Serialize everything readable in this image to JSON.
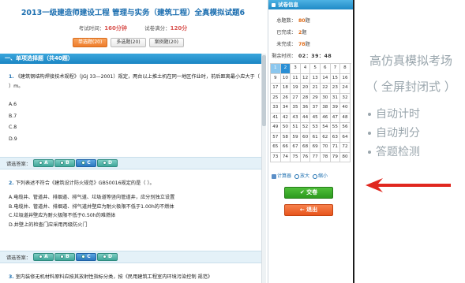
{
  "exam": {
    "title": "2013一级建造师建设工程 管理与实务（建筑工程）全真模拟试题6",
    "time_label": "考试时间：",
    "time_value": "160分钟",
    "score_label": "试卷满分：",
    "score_value": "120分",
    "tabs": [
      {
        "label": "单选题(20)",
        "active": true
      },
      {
        "label": "多选题(20)",
        "active": false
      },
      {
        "label": "案例题(20)",
        "active": false
      }
    ],
    "section_title": "一、单项选择题（共40题）"
  },
  "questions": [
    {
      "number": "1.",
      "stem": "《建筑钢结构焊接技术规程》（JGJ 33—2001）规定，两台以上推土机在同一地区作业时，前后距离最小应大于（ ）m。",
      "options": [
        "A.6",
        "B.7",
        "C.8",
        "D.9"
      ]
    },
    {
      "number": "2.",
      "stem": "下列表述不符合《建筑设计防火规范》GB50016规定的是（ ）。",
      "options": [
        "A.电缆井、管道井、排烟道、排气道、垃圾道等竖向管道井，应分别独立设置",
        "B.电缆井、管道井、排烟道、排气道井壁应为耐火极限不低于1.00h的不燃体",
        "C.垃圾道井壁应为耐火极限不低于0.50h的难燃体",
        "D.井壁上的检查门应采用丙级防火门"
      ]
    },
    {
      "number": "3.",
      "stem": "室内装修无机材料原料应按其放射性指标分类，按《民用建筑工程室内环境污染控制 规范》",
      "options": []
    }
  ],
  "answer_bar": {
    "label": "请选答案：",
    "choices": [
      "A",
      "B",
      "C",
      "D"
    ]
  },
  "panel": {
    "title": "试卷信息",
    "total_label": "总题数：",
    "total_value": "80",
    "total_unit": "题",
    "done_label": "已完成：",
    "done_value": "2",
    "done_unit": "题",
    "undone_label": "未完成：",
    "undone_value": "78",
    "undone_unit": "题",
    "countdown_label": "剩余时间：",
    "countdown_value": "02：39：48",
    "grid_numbers": [
      "1",
      "2",
      "3",
      "4",
      "5",
      "6",
      "7",
      "8",
      "9",
      "10",
      "11",
      "12",
      "13",
      "14",
      "15",
      "16",
      "17",
      "18",
      "19",
      "20",
      "21",
      "22",
      "23",
      "24",
      "25",
      "26",
      "27",
      "28",
      "29",
      "30",
      "31",
      "32",
      "33",
      "34",
      "35",
      "36",
      "37",
      "38",
      "39",
      "40",
      "41",
      "42",
      "43",
      "44",
      "45",
      "46",
      "47",
      "48",
      "49",
      "50",
      "51",
      "52",
      "53",
      "54",
      "55",
      "56",
      "57",
      "58",
      "59",
      "60",
      "61",
      "62",
      "63",
      "64",
      "65",
      "66",
      "67",
      "68",
      "69",
      "70",
      "71",
      "72",
      "73",
      "74",
      "75",
      "76",
      "77",
      "78",
      "79",
      "80"
    ],
    "tools": {
      "calculator": "计算器",
      "zoom_in": "放大",
      "zoom_out": "缩小"
    },
    "submit_label": "✔ 交卷",
    "exit_label": "← 退出"
  },
  "promo": {
    "title": "高仿真模拟考场",
    "subtitle": "（ 全屏封闭式 ）",
    "features": [
      "自动计时",
      "自动判分",
      "答题检测"
    ]
  },
  "colors": {
    "accent_blue": "#1d6fb0",
    "highlight_orange": "#e06a15",
    "submit_green": "#2c9a1e",
    "exit_orange": "#e7541c",
    "arrow_red": "#e0271f",
    "promo_gray": "#9aa6ad"
  }
}
